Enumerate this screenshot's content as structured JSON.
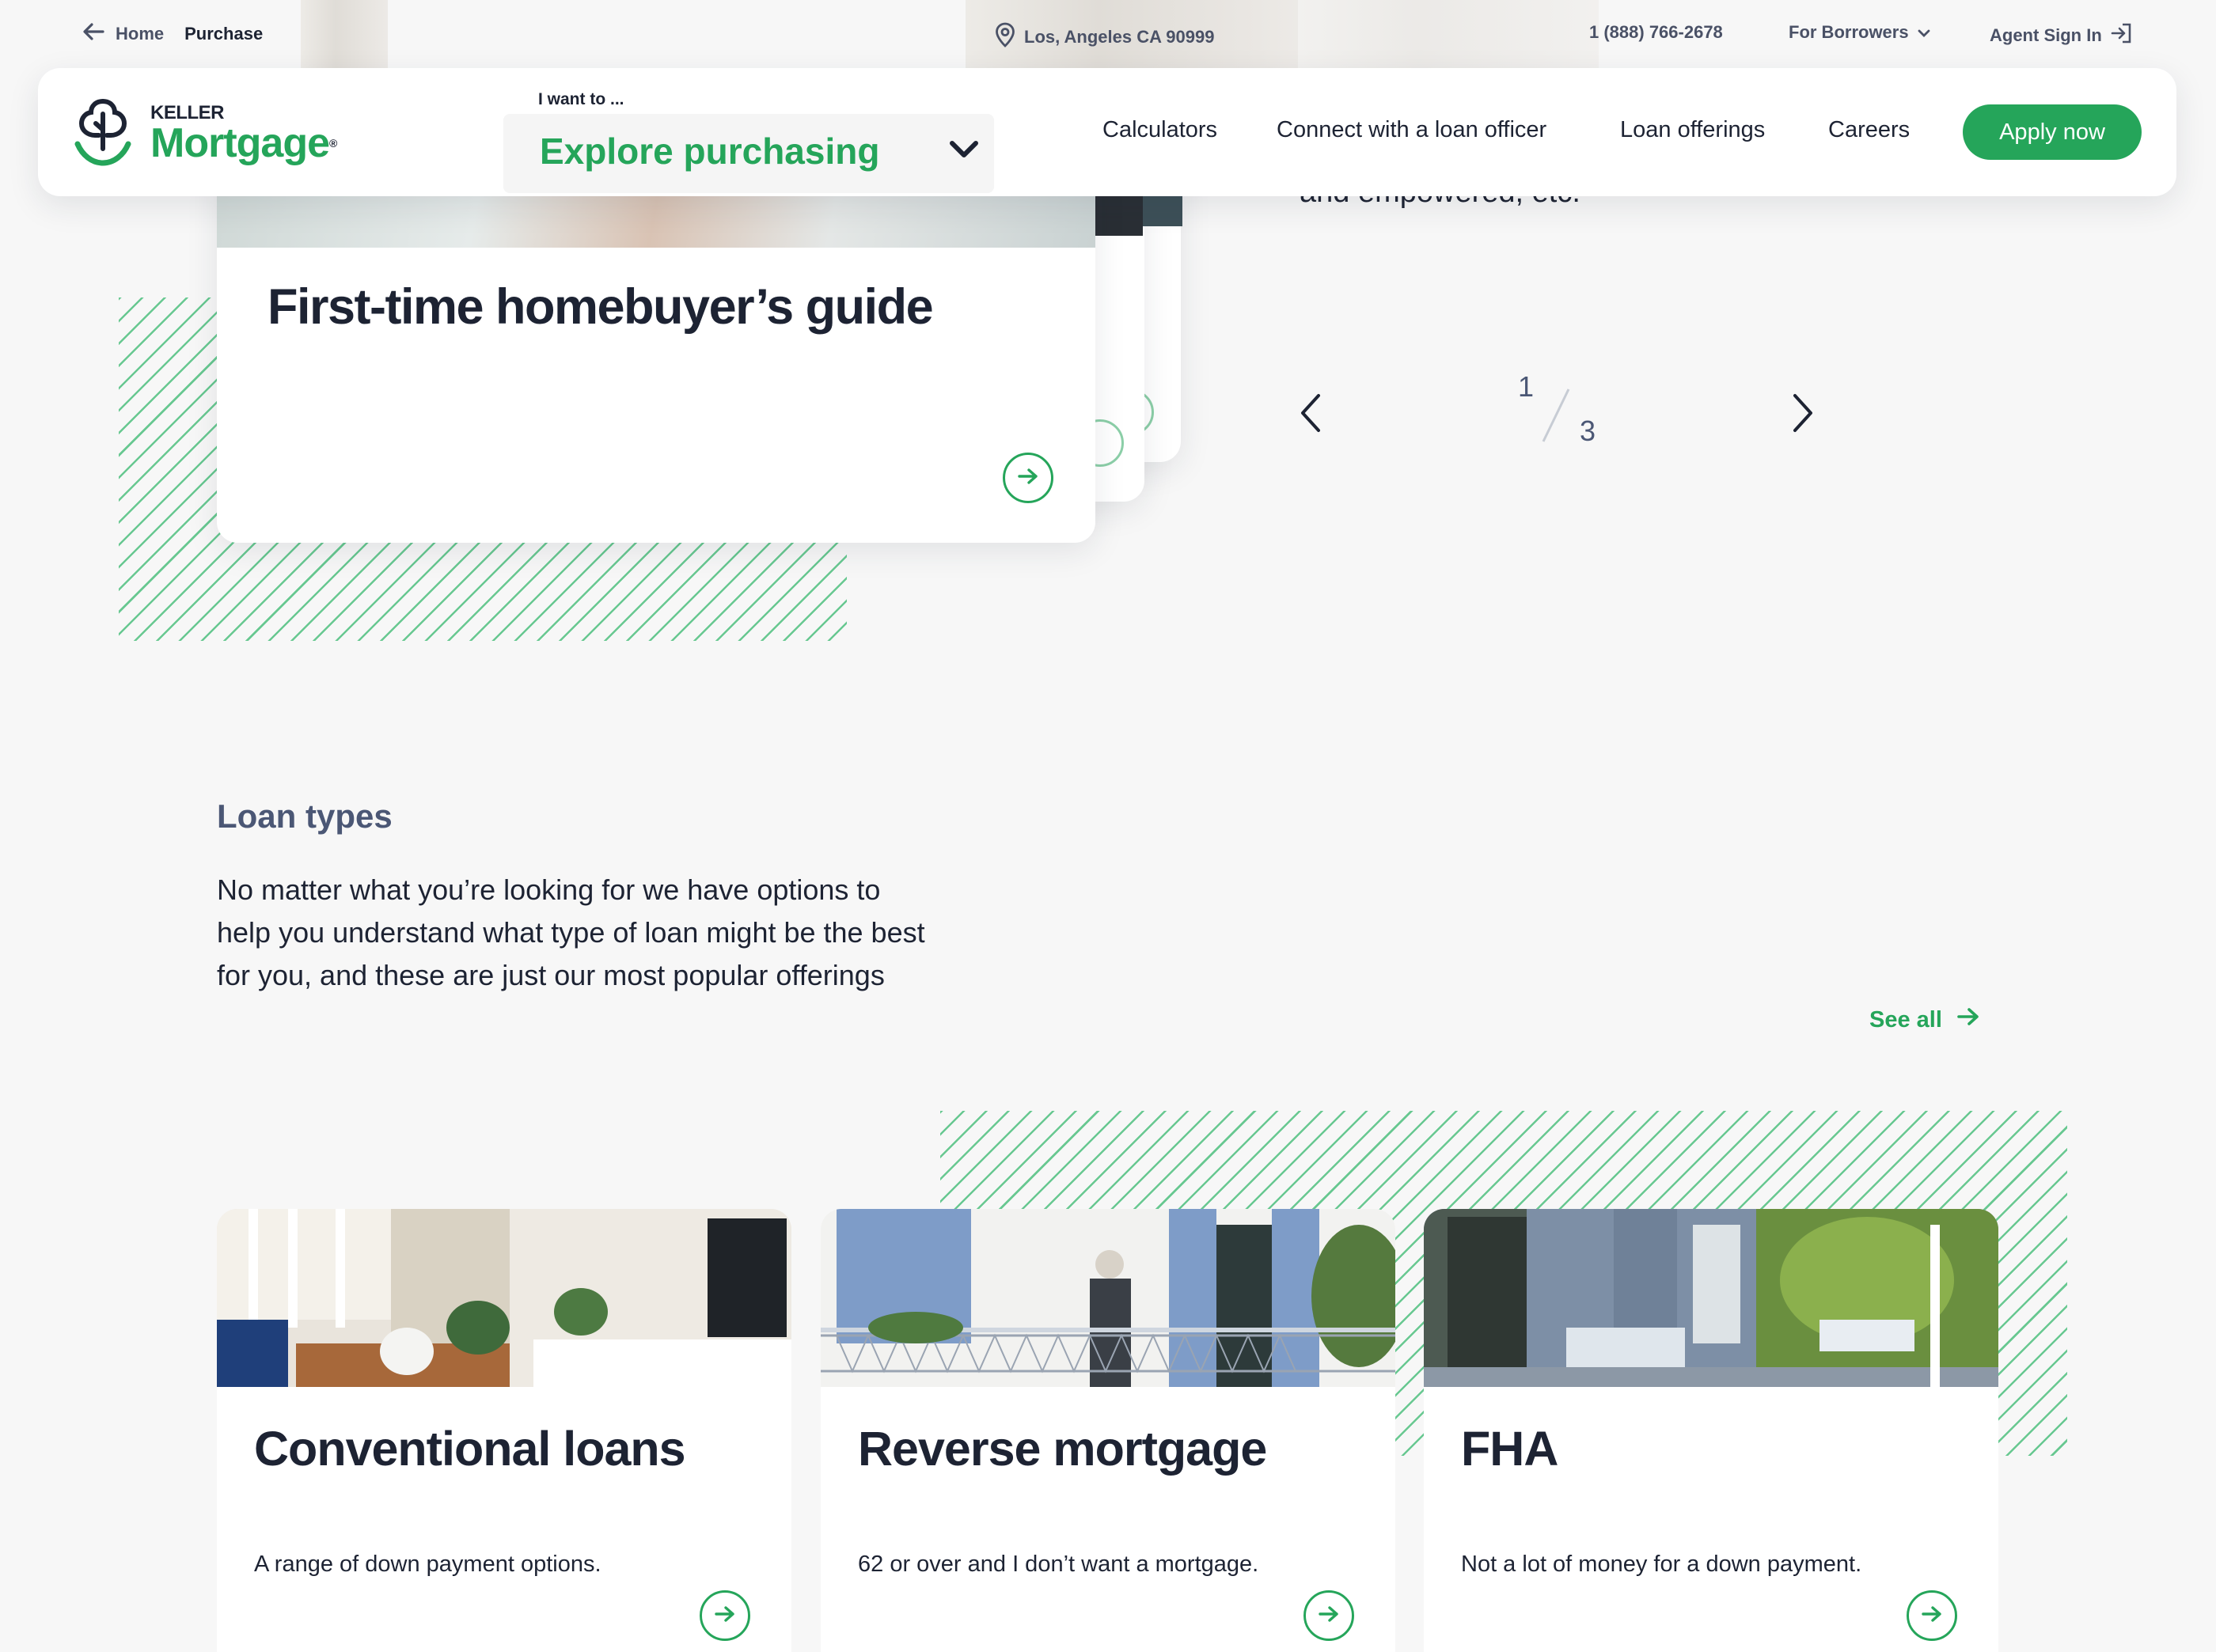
{
  "colors": {
    "brand_green": "#25a55a",
    "text_dark": "#1d2333",
    "heading_muted": "#4b5775",
    "background": "#f7f7f7"
  },
  "utility_bar": {
    "back_icon": "arrow-left-icon",
    "home_label": "Home",
    "current_label": "Purchase",
    "location_icon": "map-pin-icon",
    "location": "Los, Angeles CA 90999",
    "phone": "1 (888) 766-2678",
    "borrowers_label": "For Borrowers",
    "agent_sign_in": "Agent Sign In",
    "sign_in_icon": "sign-in-icon"
  },
  "header": {
    "logo_top": "KELLER",
    "logo_bottom": "Mortgage",
    "logo_registered": "®",
    "intent_label": "I want to ...",
    "intent_value": "Explore purchasing",
    "nav": [
      "Calculators",
      "Connect with a loan officer",
      "Loan offerings",
      "Careers"
    ],
    "apply_label": "Apply now"
  },
  "carousel": {
    "card_title": "First-time homebuyer’s guide",
    "partial_text": "and empowered, etc.",
    "current": "1",
    "total": "3"
  },
  "loan_section": {
    "title": "Loan types",
    "description": "No matter what you’re looking for we have options to help you understand what type of loan might be the best for you, and these are just our most popular offerings",
    "see_all": "See all",
    "cards": [
      {
        "title": "Conventional loans",
        "description": "A range of down payment options.",
        "image": "living-room-photo"
      },
      {
        "title": "Reverse mortgage",
        "description": "62 or over and I don’t want a mortgage.",
        "image": "balcony-woman-photo"
      },
      {
        "title": "FHA",
        "description": "Not a lot of money for a down payment.",
        "image": "front-porch-photo"
      }
    ]
  }
}
